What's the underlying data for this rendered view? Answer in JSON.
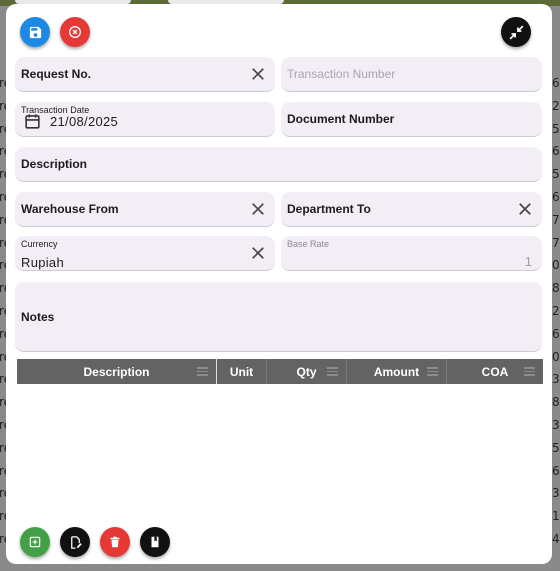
{
  "background": {
    "right_glyphs": [
      "6",
      "2",
      "5",
      "6",
      "5",
      "6",
      "7",
      "7",
      "0",
      "8",
      "2",
      "6",
      "0",
      "3",
      "8",
      "3",
      "5",
      "6",
      "3",
      "1",
      "4"
    ],
    "left_glyphs": [
      "re",
      "re",
      "re",
      "re",
      "re",
      "re",
      "re",
      "re",
      "re",
      "re",
      "re",
      "re",
      "re",
      "re",
      "re",
      "re",
      "re",
      "re",
      "re",
      "re",
      "re"
    ]
  },
  "toolbar": {
    "save_icon": "floppy-disk-icon",
    "cancel_icon": "close-circle-icon",
    "collapse_icon": "collapse-arrows-icon"
  },
  "form": {
    "request_no": {
      "label": "Request No."
    },
    "transaction_number": {
      "placeholder": "Transaction Number"
    },
    "transaction_date": {
      "label": "Transaction Date",
      "value": "21/08/2025"
    },
    "document_number": {
      "label": "Document Number"
    },
    "description": {
      "label": "Description"
    },
    "warehouse_from": {
      "label": "Warehouse From"
    },
    "department_to": {
      "label": "Department To"
    },
    "currency": {
      "label": "Currency",
      "value": "Rupiah"
    },
    "base_rate": {
      "label": "Base Rate",
      "value": "1"
    },
    "notes": {
      "label": "Notes"
    }
  },
  "table": {
    "columns": [
      "Description",
      "Unit",
      "Qty",
      "Amount",
      "COA"
    ]
  },
  "actions": {
    "add_icon": "add-icon",
    "edit_icon": "edit-document-icon",
    "delete_icon": "trash-icon",
    "view_icon": "book-icon"
  },
  "colors": {
    "accent_blue": "#1e88e5",
    "danger_red": "#e53935",
    "success_green": "#43a047",
    "field_bg": "#f3eef6",
    "header_gray": "#636363"
  }
}
